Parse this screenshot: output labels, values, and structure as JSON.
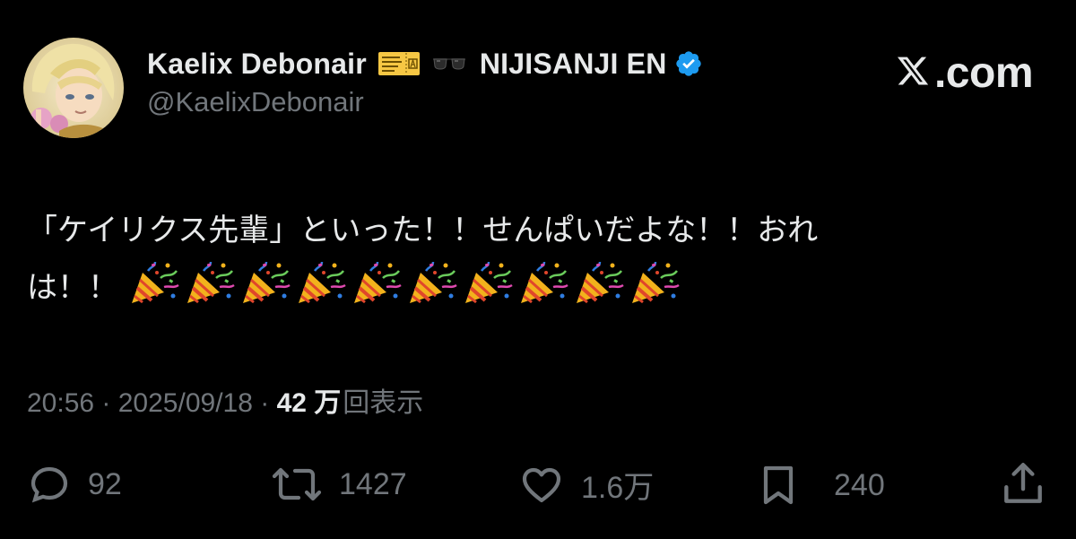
{
  "tweet": {
    "author": {
      "display_name": "Kaelix Debonair",
      "name_suffix": "NIJISANJI EN",
      "handle": "@KaelixDebonair",
      "emojis": [
        "ticket-icon",
        "sunglasses-icon"
      ],
      "verified": true
    },
    "brand": {
      "text": ".com",
      "logo": "x-logo-icon"
    },
    "text": {
      "line1": "「ケイリクス先輩」といった！！せんぱいだよな！！おれ",
      "line2_prefix": "は！！",
      "party_emoji_count": 10,
      "party_emoji": "party-popper-icon"
    },
    "meta": {
      "time": "20:56",
      "separator": " · ",
      "date": "2025/09/18",
      "views_number": "42 万",
      "views_label": "回表示"
    },
    "actions": {
      "replies": "92",
      "reposts": "1427",
      "likes": "1.6万",
      "bookmarks": "240"
    }
  },
  "colors": {
    "background": "#000000",
    "text_primary": "#e7e9ea",
    "text_secondary": "#71767b",
    "verified_blue": "#1d9bf0"
  }
}
